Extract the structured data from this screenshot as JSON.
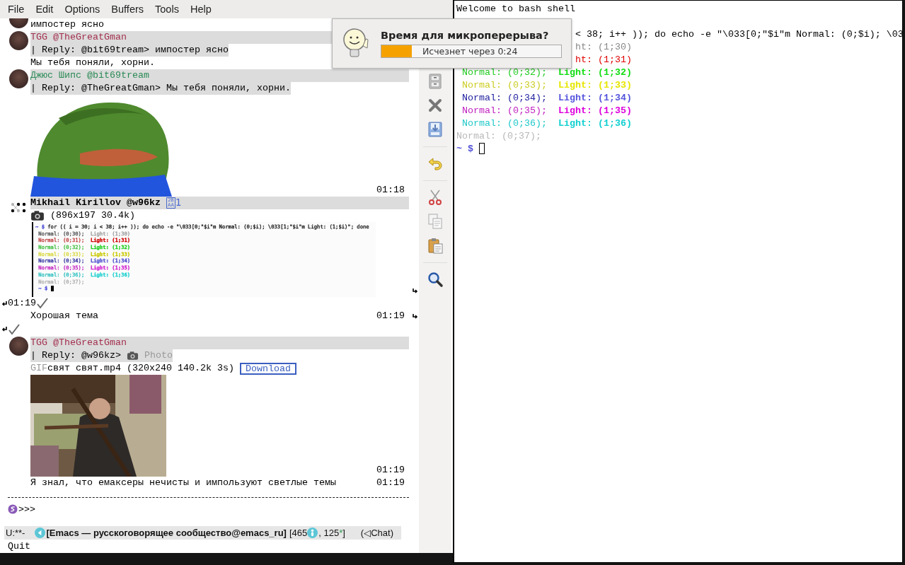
{
  "menu": [
    "File",
    "Edit",
    "Options",
    "Buffers",
    "Tools",
    "Help"
  ],
  "chat": {
    "lines": [
      {
        "kind": "text",
        "avatar": true,
        "text": "импостер ясно"
      },
      {
        "kind": "header",
        "avatar": true,
        "name": "TGG @TheGreatGman",
        "color": "#a3304f",
        "bold": false
      },
      {
        "kind": "reply",
        "text": "| Reply: @bit69tream> импостер ясно"
      },
      {
        "kind": "text",
        "text": "Мы тебя поняли, хорни."
      },
      {
        "kind": "header",
        "avatar": true,
        "name": "Джюс Шипс @bit69tream",
        "color": "#2a8a55",
        "bold": false
      },
      {
        "kind": "reply",
        "text": "| Reply: @TheGreatGman> Мы тебя поняли, хорни."
      },
      {
        "kind": "picture",
        "time": "01:18"
      },
      {
        "kind": "header",
        "dots": true,
        "name": "Mikhail Kirillov @w96kz",
        "color": "#000000",
        "bold": true,
        "glyph": [
          "2B",
          "AA"
        ],
        "count": "1"
      },
      {
        "kind": "attachment",
        "text": "(896x197 30.4k)"
      },
      {
        "kind": "screenshot",
        "fringe_right": true,
        "lines": [
          {
            "kind": "command",
            "prompt": "~ $",
            "text": "for (( i = 30; i < 38; i++ )); do echo -e \"\\033[0;\"$i\"m Normal: (0;$i); \\033[1;\"$i\"m Light: (1;$i)\"; done"
          },
          {
            "kind": "pair",
            "segments": [
              {
                "text": "Normal: (0;30);",
                "color": "#555555",
                "bold": false
              },
              {
                "text": "Light: (1;30)",
                "color": "#999999",
                "bold": false
              }
            ]
          },
          {
            "kind": "pair",
            "segments": [
              {
                "text": "Normal: (0;31);",
                "color": "#c04040",
                "bold": false
              },
              {
                "text": "Light: (1;31)",
                "color": "#d00000",
                "bold": true
              }
            ]
          },
          {
            "kind": "pair",
            "segments": [
              {
                "text": "Normal: (0;32);",
                "color": "#40c040",
                "bold": false
              },
              {
                "text": "Light: (1;32)",
                "color": "#20d020",
                "bold": true
              }
            ]
          },
          {
            "kind": "pair",
            "segments": [
              {
                "text": "Normal: (0;33);",
                "color": "#d8d840",
                "bold": false
              },
              {
                "text": "Light: (1;33)",
                "color": "#c8c800",
                "bold": true
              }
            ]
          },
          {
            "kind": "pair",
            "segments": [
              {
                "text": "Normal: (0;34);",
                "color": "#3030a0",
                "bold": false
              },
              {
                "text": "Light: (1;34)",
                "color": "#5050d0",
                "bold": true
              }
            ]
          },
          {
            "kind": "pair",
            "segments": [
              {
                "text": "Normal: (0;35);",
                "color": "#c020c0",
                "bold": false
              },
              {
                "text": "Light: (1;35)",
                "color": "#d020d0",
                "bold": true
              }
            ]
          },
          {
            "kind": "pair",
            "segments": [
              {
                "text": "Normal: (0;36);",
                "color": "#30c0c0",
                "bold": false
              },
              {
                "text": "Light: (1;36)",
                "color": "#20d0d0",
                "bold": true
              }
            ]
          },
          {
            "kind": "plain",
            "text": "Normal: (0;37);",
            "color": "#b0b0b0"
          },
          {
            "kind": "prompt",
            "prompt": "~ $",
            "cursor": true
          }
        ]
      },
      {
        "kind": "status",
        "time": "01:19",
        "fringe_left": true
      },
      {
        "kind": "text",
        "text": "Хорошая тема",
        "time": "01:19",
        "fringe_right": true
      },
      {
        "kind": "check",
        "fringe_left": true
      },
      {
        "kind": "header",
        "avatar": true,
        "name": "TGG @TheGreatGman",
        "color": "#a3304f",
        "bold": false
      },
      {
        "kind": "reply",
        "text": "| Reply: @w96kz>",
        "media": "Photo"
      },
      {
        "kind": "file",
        "prefix": "GIF",
        "text": "свят свят.mp4 (320x240 140.2k 3s)",
        "button": "Download"
      },
      {
        "kind": "picture",
        "time": "01:19"
      },
      {
        "kind": "text",
        "text": "Я знал, что емаксеры нечисты и импользуют светлые темы",
        "time": "01:19"
      }
    ]
  },
  "input": {
    "prompt": ">>>"
  },
  "mode_line": {
    "state": "U:**-",
    "buffer": "[Emacs — русскоговорящее сообщество@emacs_ru]",
    "count_open": "[465",
    "count_rest": ", 125",
    "star": "*",
    "count_close": "]",
    "mode": "(◁Chat)"
  },
  "echo": "Quit",
  "popup": {
    "title": "Время для микроперерыва?",
    "countdown": "Исчезнет через 0:24",
    "level": 0.17
  },
  "terminal": {
    "lines": [
      {
        "kind": "plain",
        "text": "Welcome to bash shell",
        "color": "#000000"
      },
      {
        "kind": "plain",
        "text": "< 38; i++ )); do echo -e \"\\033[0;\"$i\"m Normal: (0;$i); \\03",
        "color": "#000000"
      },
      {
        "kind": "plain",
        "text": "ht: (1;30)",
        "color": "#888888"
      },
      {
        "kind": "plain",
        "text": "ht: (1;31)",
        "color": "#e00000"
      },
      {
        "kind": "pair",
        "segments": [
          {
            "text": "Normal: (0;32);",
            "color": "#22cc22",
            "bold": false
          },
          {
            "text": "Light: (1;32)",
            "color": "#11dd11",
            "bold": true
          }
        ]
      },
      {
        "kind": "pair",
        "segments": [
          {
            "text": "Normal: (0;33);",
            "color": "#cccc22",
            "bold": false
          },
          {
            "text": "Light: (1;33)",
            "color": "#e6e600",
            "bold": true
          }
        ]
      },
      {
        "kind": "pair",
        "segments": [
          {
            "text": "Normal: (0;34);",
            "color": "#2020a0",
            "bold": false
          },
          {
            "text": "Light: (1;34)",
            "color": "#5555dd",
            "bold": true
          }
        ]
      },
      {
        "kind": "pair",
        "segments": [
          {
            "text": "Normal: (0;35);",
            "color": "#c020c0",
            "bold": false
          },
          {
            "text": "Light: (1;35)",
            "color": "#dd00dd",
            "bold": true
          }
        ]
      },
      {
        "kind": "pair",
        "segments": [
          {
            "text": "Normal: (0;36);",
            "color": "#20c8c8",
            "bold": false
          },
          {
            "text": "Light: (1;36)",
            "color": "#11d0d0",
            "bold": true
          }
        ]
      },
      {
        "kind": "plain",
        "text": "Normal: (0;37);",
        "color": "#b8b8b8"
      },
      {
        "kind": "prompt",
        "prompt": "~ $",
        "cursor": true
      }
    ]
  }
}
